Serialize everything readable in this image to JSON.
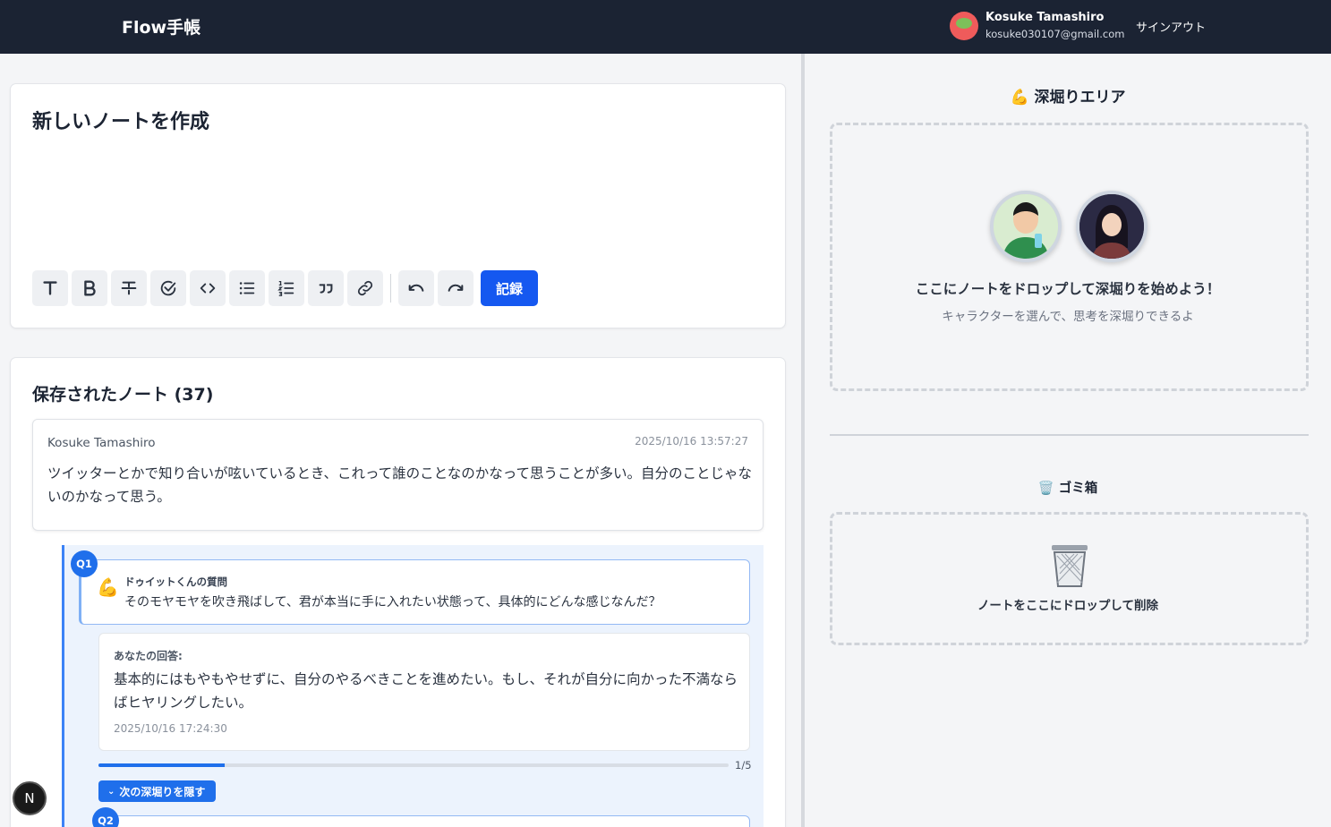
{
  "header": {
    "brand": "Flow手帳",
    "user_name": "Kosuke Tamashiro",
    "user_email": "kosuke030107@gmail.com",
    "signout_label": "サインアウト"
  },
  "editor": {
    "title": "新しいノートを作成",
    "toolbar": [
      "text-icon",
      "bold-icon",
      "strikethrough-icon",
      "checklist-icon",
      "code-icon",
      "bullet-list-icon",
      "ordered-list-icon",
      "quote-icon",
      "link-icon",
      "undo-icon",
      "redo-icon"
    ],
    "record_label": "記録"
  },
  "notes": {
    "title": "保存されたノート (37)",
    "items": [
      {
        "author": "Kosuke Tamashiro",
        "date": "2025/10/16 13:57:27",
        "body": "ツイッターとかで知り合いが呟いているとき、これって誰のことなのかなって思うことが多い。自分のことじゃないのかなって思う。"
      }
    ]
  },
  "thread": {
    "q1_badge": "Q1",
    "q1_who": "ドゥイットくんの質問",
    "q1_emoji": "💪",
    "q1_text": "そのモヤモヤを吹き飛ばして、君が本当に手に入れたい状態って、具体的にどんな感じなんだ？",
    "answer_label": "あなたの回答:",
    "answer_text": "基本的にはもやもやせずに、自分のやるべきことを進めたい。もし、それが自分に向かった不満ならばヒヤリングしたい。",
    "answer_date": "2025/10/16 17:24:30",
    "progress_label": "1/5",
    "progress_fraction": 0.2,
    "hide_label": "次の深堀りを隠す",
    "q2_badge": "Q2"
  },
  "right": {
    "area_title": "💪 深堀りエリア",
    "drop_title": "ここにノートをドロップして深堀りを始めよう！",
    "drop_sub": "キャラクターを選んで、思考を深堀りできるよ",
    "trash_title": "🗑️ ゴミ箱",
    "trash_text": "ノートをここにドロップして削除"
  },
  "dev_badge": "N",
  "colors": {
    "header_bg": "#1b2333",
    "accent": "#1558f0",
    "thread_bg": "#ecf3fd"
  }
}
